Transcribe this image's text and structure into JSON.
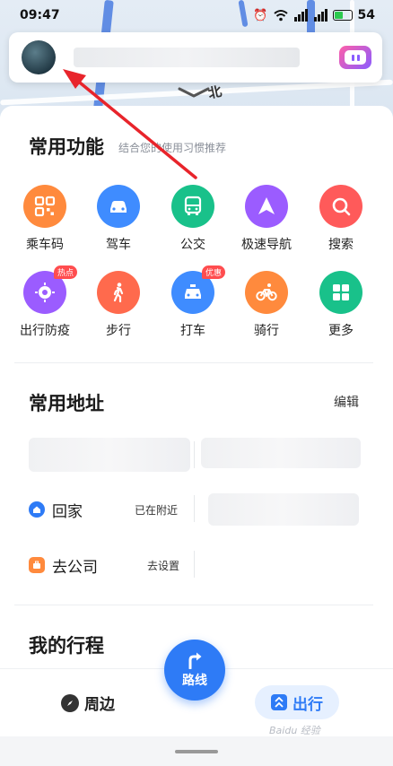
{
  "status_bar": {
    "time": "09:47",
    "battery": "54"
  },
  "map": {
    "road_label": "北"
  },
  "header": {
    "voice_icon": "voice-assistant-icon"
  },
  "common_functions": {
    "title": "常用功能",
    "subtitle": "结合您的使用习惯推荐",
    "items": [
      {
        "label": "乘车码",
        "icon": "qrcode-icon",
        "color": "#ff8a3d"
      },
      {
        "label": "驾车",
        "icon": "car-icon",
        "color": "#3f8cff"
      },
      {
        "label": "公交",
        "icon": "bus-icon",
        "color": "#19c18a"
      },
      {
        "label": "极速导航",
        "icon": "navigation-arrow-icon",
        "color": "#9b5cff"
      },
      {
        "label": "搜索",
        "icon": "search-icon",
        "color": "#ff5a5a"
      },
      {
        "label": "出行防疫",
        "icon": "virus-shield-icon",
        "color": "#9b5cff",
        "badge": "热点"
      },
      {
        "label": "步行",
        "icon": "walk-icon",
        "color": "#ff6a4d"
      },
      {
        "label": "打车",
        "icon": "taxi-icon",
        "color": "#3f8cff",
        "badge": "优惠"
      },
      {
        "label": "骑行",
        "icon": "bike-icon",
        "color": "#ff8a3d"
      },
      {
        "label": "更多",
        "icon": "grid-icon",
        "color": "#19c18a"
      }
    ]
  },
  "common_addresses": {
    "title": "常用地址",
    "edit_label": "编辑",
    "home_label": "回家",
    "home_hint": "已在附近",
    "home_color": "#2e7bf6",
    "company_label": "去公司",
    "company_hint": "去设置",
    "company_color": "#ff8a3d"
  },
  "my_trips": {
    "title": "我的行程"
  },
  "bottom_nav": {
    "nearby_label": "周边",
    "route_label": "路线",
    "travel_label": "出行",
    "accent": "#2e7bf6"
  },
  "watermark": "Baidu 经验"
}
